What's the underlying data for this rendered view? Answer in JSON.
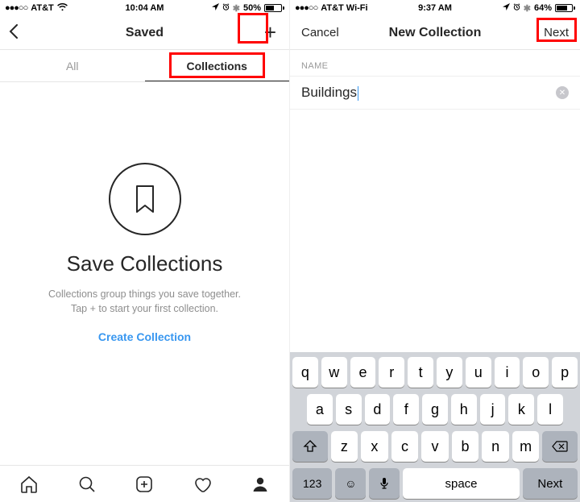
{
  "left": {
    "status": {
      "carrier": "AT&T",
      "time": "10:04 AM",
      "battery_pct": "50%",
      "battery_fill_pct": 50
    },
    "nav": {
      "title": "Saved"
    },
    "tabs": {
      "all": "All",
      "collections": "Collections"
    },
    "empty": {
      "heading": "Save Collections",
      "body_line1": "Collections group things you save together.",
      "body_line2": "Tap + to start your first collection.",
      "cta": "Create Collection"
    }
  },
  "right": {
    "status": {
      "carrier": "AT&T Wi-Fi",
      "time": "9:37 AM",
      "battery_pct": "64%",
      "battery_fill_pct": 64
    },
    "nav": {
      "cancel": "Cancel",
      "title": "New Collection",
      "next": "Next"
    },
    "form": {
      "section": "NAME",
      "value": "Buildings"
    },
    "keyboard": {
      "row1": [
        "q",
        "w",
        "e",
        "r",
        "t",
        "y",
        "u",
        "i",
        "o",
        "p"
      ],
      "row2": [
        "a",
        "s",
        "d",
        "f",
        "g",
        "h",
        "j",
        "k",
        "l"
      ],
      "row3": [
        "z",
        "x",
        "c",
        "v",
        "b",
        "n",
        "m"
      ],
      "fn": {
        "num": "123",
        "space": "space",
        "next": "Next"
      }
    }
  }
}
